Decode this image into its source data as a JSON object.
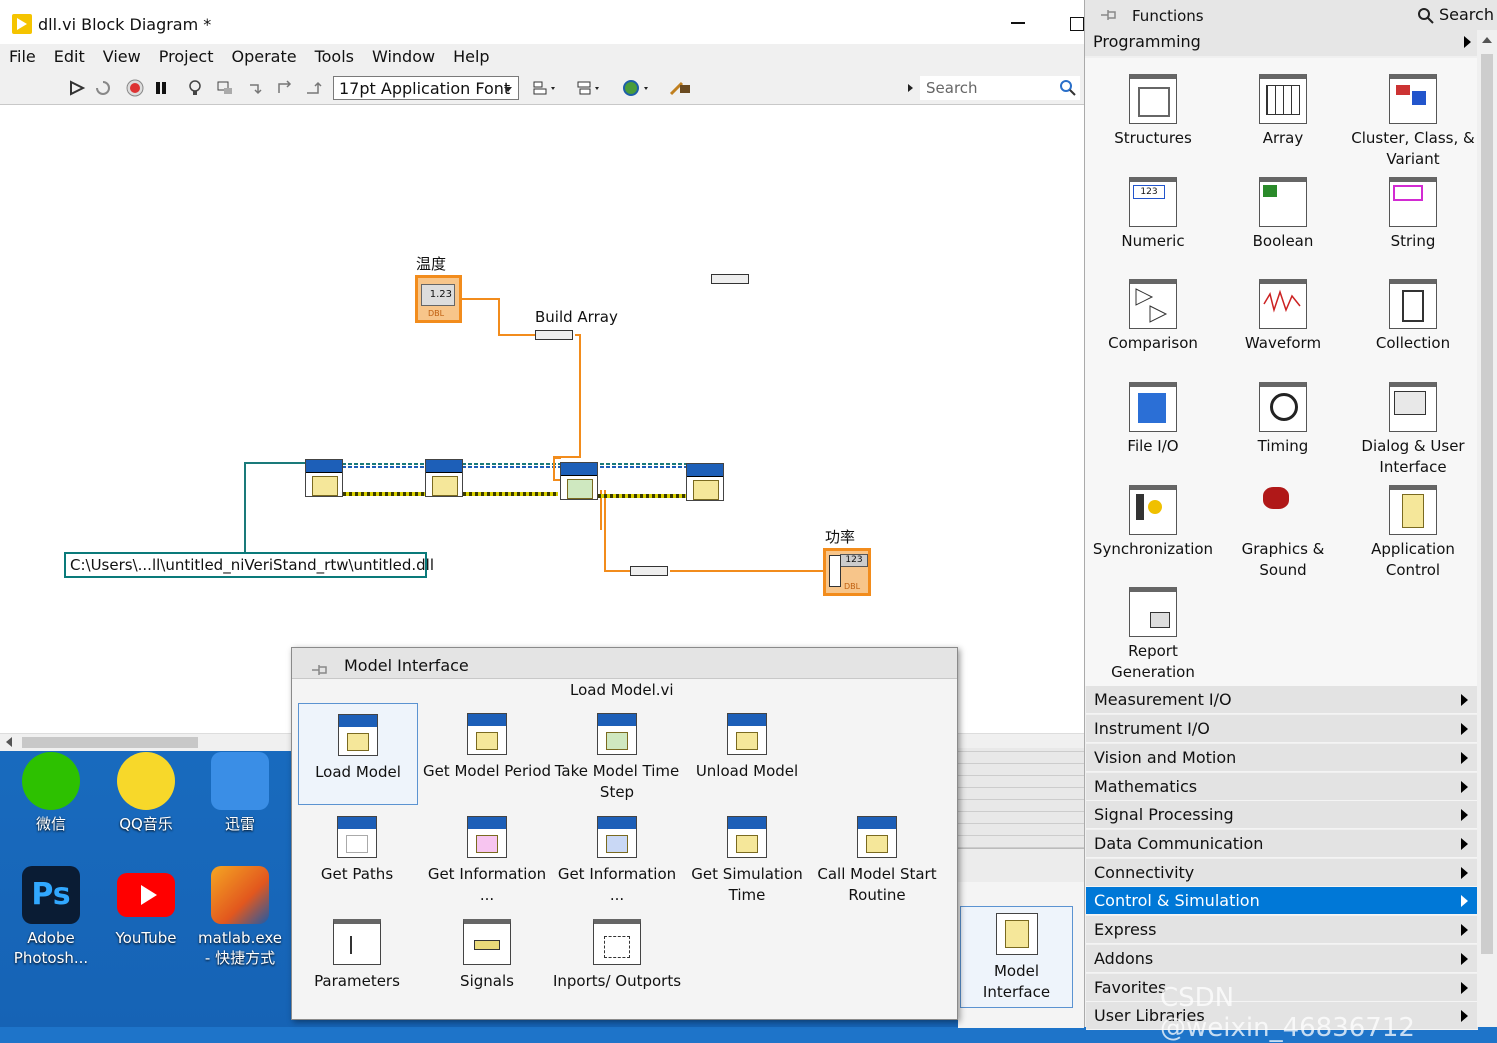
{
  "window": {
    "title": "dll.vi Block Diagram *",
    "menu": [
      "File",
      "Edit",
      "View",
      "Project",
      "Operate",
      "Tools",
      "Window",
      "Help"
    ],
    "font_selector": "17pt Application Font",
    "search_placeholder": "Search"
  },
  "diagram": {
    "labels": {
      "temperature": "温度",
      "build_array": "Build Array",
      "power": "功率"
    },
    "temperature_terminal": "1.23",
    "temperature_type": "DBL",
    "power_terminal": "123",
    "power_type": "DBL",
    "path_constant": "C:\\Users\\...ll\\untitled_niVeriStand_rtw\\untitled.dll"
  },
  "functions_palette": {
    "title": "Functions",
    "search_label": "Search",
    "section": "Programming",
    "items": [
      {
        "label": "Structures",
        "icon": "structures-icon"
      },
      {
        "label": "Array",
        "icon": "array-icon"
      },
      {
        "label": "Cluster, Class, & Variant",
        "icon": "cluster-icon"
      },
      {
        "label": "Numeric",
        "icon": "numeric-icon"
      },
      {
        "label": "Boolean",
        "icon": "boolean-icon"
      },
      {
        "label": "String",
        "icon": "string-icon"
      },
      {
        "label": "Comparison",
        "icon": "comparison-icon"
      },
      {
        "label": "Waveform",
        "icon": "waveform-icon"
      },
      {
        "label": "Collection",
        "icon": "collection-icon"
      },
      {
        "label": "File I/O",
        "icon": "file-io-icon"
      },
      {
        "label": "Timing",
        "icon": "timing-icon"
      },
      {
        "label": "Dialog & User Interface",
        "icon": "dialog-icon"
      },
      {
        "label": "Synchronization",
        "icon": "synchronization-icon"
      },
      {
        "label": "Graphics & Sound",
        "icon": "graphics-sound-icon"
      },
      {
        "label": "Application Control",
        "icon": "application-control-icon"
      },
      {
        "label": "Report Generation",
        "icon": "report-generation-icon"
      }
    ],
    "categories": [
      "Measurement I/O",
      "Instrument I/O",
      "Vision and Motion",
      "Mathematics",
      "Signal Processing",
      "Data Communication",
      "Connectivity",
      "Control & Simulation",
      "Express",
      "Addons",
      "Favorites",
      "User Libraries"
    ],
    "selected_category": "Control & Simulation"
  },
  "model_palette": {
    "title": "Model Interface",
    "hover_label": "Load Model.vi",
    "items": [
      {
        "label": "Load Model"
      },
      {
        "label": "Get Model Period"
      },
      {
        "label": "Take Model Time Step"
      },
      {
        "label": "Unload Model"
      },
      {
        "label": "Get Paths"
      },
      {
        "label": "Get Information ..."
      },
      {
        "label": "Get Information ..."
      },
      {
        "label": "Get Simulation Time"
      },
      {
        "label": "Call Model Start Routine"
      },
      {
        "label": "Parameters"
      },
      {
        "label": "Signals"
      },
      {
        "label": "Inports/ Outports"
      }
    ]
  },
  "behind_palette": {
    "label": "Model Interface"
  },
  "desktop": {
    "icons": [
      {
        "label": "微信",
        "icon": "wechat-icon",
        "color": "#2dc100"
      },
      {
        "label": "QQ音乐",
        "icon": "qqmusic-icon",
        "color": "#f7d82a"
      },
      {
        "label": "迅雷",
        "icon": "xunlei-icon",
        "color": "#3a8ee6"
      },
      {
        "label": "Adobe Photosh...",
        "icon": "photoshop-icon",
        "color": "#0a1c34"
      },
      {
        "label": "YouTube",
        "icon": "youtube-icon",
        "color": "#ff0000"
      },
      {
        "label": "matlab.exe - 快捷方式",
        "icon": "matlab-icon",
        "color": "#e2571e"
      }
    ]
  },
  "watermark": "CSDN @weixin_46836712"
}
